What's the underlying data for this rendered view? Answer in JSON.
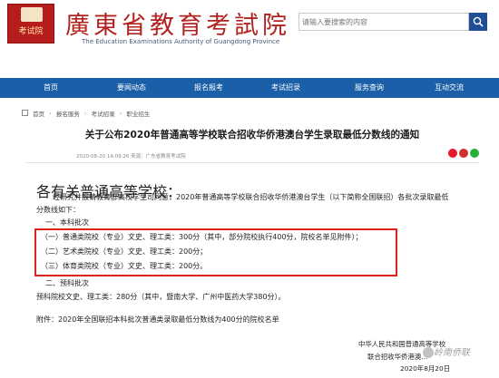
{
  "header": {
    "logo_text": "考试院",
    "title": "廣東省教育考試院",
    "subtitle": "The Education Examinations Authority of Guangdong Province",
    "search_placeholder": "请输入要搜索的内容"
  },
  "nav": {
    "items": [
      "首页",
      "要闻动态",
      "报名报考",
      "考试招录",
      "服务查询",
      "互动交流"
    ]
  },
  "breadcrumb": {
    "items": [
      "首页",
      "badge-placeholder",
      "考试招录",
      "职业招生"
    ],
    "display": [
      "首页",
      "报名服务",
      "考试招录",
      "职业招生"
    ]
  },
  "article": {
    "title": "关于公布2020年普通高等学校联合招收华侨港澳台学生录取最低分数线的通知",
    "meta": "2020-08-20 14:09:26    来源：广东省教育考试院",
    "greeting": "各有关普通高等学校：",
    "p1_line1": "经研究并报请教育部高校学生司同意，2020年普通高等学校联合招收华侨港澳台学生（以下简称全国联招）各批次录取最低",
    "p1_line2": "分数线如下：",
    "section1": "一、本科批次",
    "item1": "（一）普通类院校（专业）文史、理工类：300分（其中，部分院校执行400分，院校名单见附件）；",
    "item2": "（二）艺术类院校（专业）文史、理工类：200分；",
    "item3": "（三）体育类院校（专业）文史、理工类：200分。",
    "section2": "二、预科批次",
    "prep": "预科院校文史、理工类：280分（其中，暨南大学、广州中医药大学380分）。",
    "attachment": "附件：2020年全国联招本科批次普通类录取最低分数线为400分的院校名单",
    "sign1": "中华人民共和国普通高等学校",
    "sign2": "联合招收华侨港澳...",
    "sign3": "2020年8月20日",
    "watermark": "岭南侨联"
  }
}
